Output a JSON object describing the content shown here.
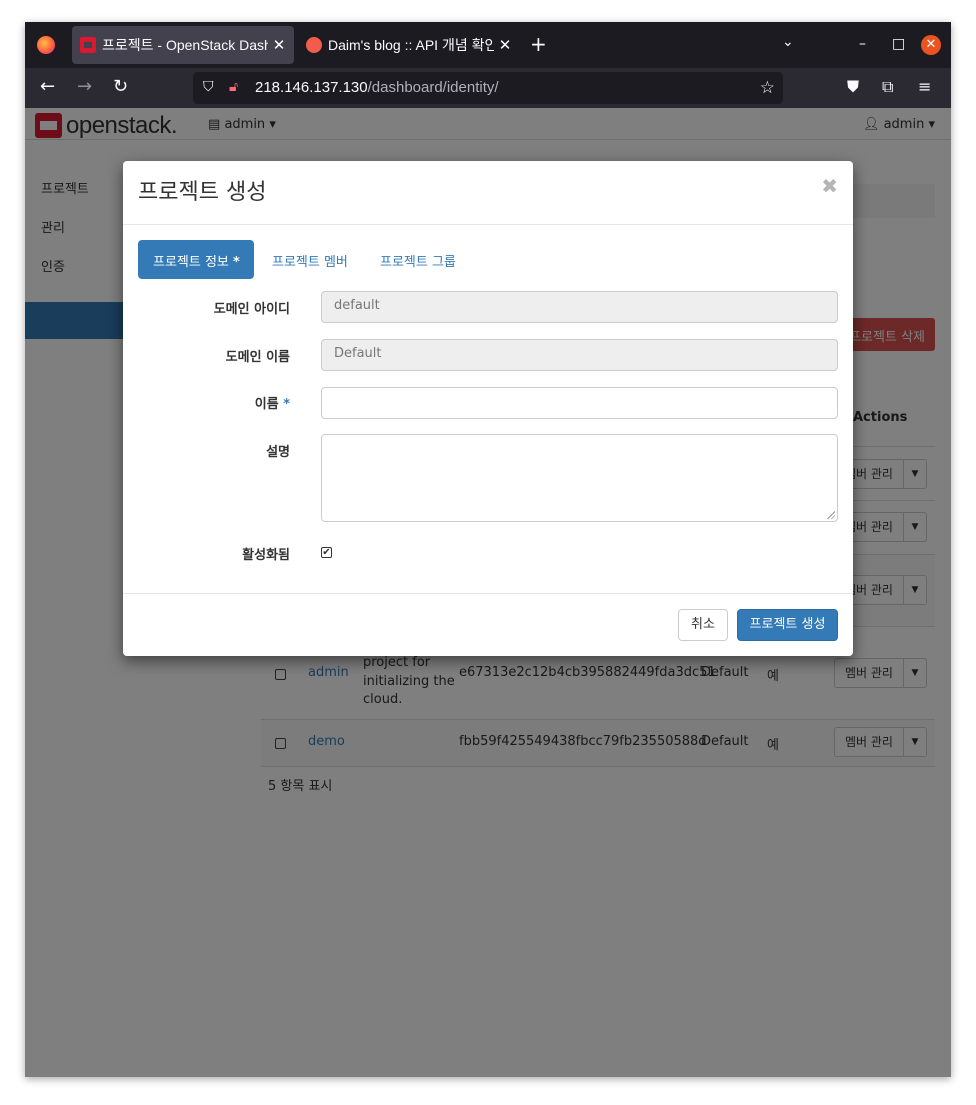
{
  "browser": {
    "tabs": [
      {
        "title": "프로젝트 - OpenStack Dashboard",
        "active": true,
        "favicon": "openstack-favicon"
      },
      {
        "title": "Daim's blog :: API 개념 확인",
        "active": false,
        "favicon": "daim-favicon"
      }
    ],
    "new_tab": "+",
    "tabs_list": "⌄",
    "window_controls": {
      "minimize": "–",
      "maximize": "□",
      "close": "✕"
    },
    "url_host": "218.146.137.130",
    "url_path": "/dashboard/identity/",
    "nav_icons": [
      "back-icon",
      "forward-icon",
      "reload-icon",
      "shield-icon",
      "insecure-lock-icon",
      "bookmark-star-icon",
      "pocket-icon",
      "extensions-icon",
      "menu-icon"
    ]
  },
  "header": {
    "logo_text": "openstack.",
    "project_picker": "admin",
    "user_menu": "admin"
  },
  "sidebar": {
    "items": [
      {
        "label": "프로젝트"
      },
      {
        "label": "관리"
      },
      {
        "label": "인증"
      }
    ]
  },
  "background": {
    "delete_button": "프로젝트 삭제",
    "actions_header": "Actions",
    "row_action_label": "멤버 관리",
    "rows": [
      {
        "name": "admin",
        "description_lines": [
          "project for",
          "initializing the",
          "cloud."
        ],
        "project_id": "e67313e2c12b4cb395882449fda3dc51",
        "domain": "Default",
        "enabled": "예"
      },
      {
        "name": "demo",
        "description_lines": [],
        "project_id": "fbb59f425549438fbcc79fb23550588d",
        "domain": "Default",
        "enabled": "예"
      }
    ],
    "summary": "5 항목 표시"
  },
  "modal": {
    "title": "프로젝트 생성",
    "close": "✖",
    "tabs": [
      {
        "label": "프로젝트 정보",
        "required": "*",
        "active": true
      },
      {
        "label": "프로젝트 멤버",
        "active": false
      },
      {
        "label": "프로젝트 그룹",
        "active": false
      }
    ],
    "fields": {
      "domain_id": {
        "label": "도메인 아이디",
        "value": "default"
      },
      "domain_name": {
        "label": "도메인 이름",
        "value": "Default"
      },
      "name": {
        "label": "이름",
        "required": "*",
        "value": ""
      },
      "description": {
        "label": "설명",
        "value": ""
      },
      "enabled": {
        "label": "활성화됨",
        "checked": true,
        "mark": "✔"
      }
    },
    "buttons": {
      "cancel": "취소",
      "submit": "프로젝트 생성"
    }
  },
  "colors": {
    "accent": "#337ab7",
    "danger": "#d9534f",
    "openstack_red": "#da1a32"
  }
}
